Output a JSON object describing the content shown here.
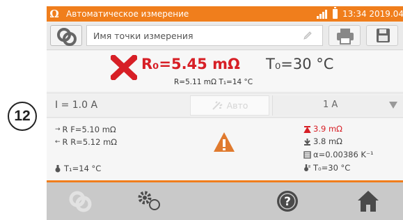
{
  "step_number": "12",
  "statusbar": {
    "app_icon": "omega-icon",
    "title": "Автоматическое измерение",
    "datetime": "13:34 2019.04.10"
  },
  "name_bar": {
    "placeholder": "Имя точки измерения"
  },
  "result": {
    "main_resistance": "R₀=5.45 mΩ",
    "main_temperature": "T₀=30 °C",
    "sub": "R=5.11 mΩ T₁=14 °C",
    "status_icon": "fail-x-icon"
  },
  "current": {
    "label": "I = 1.0 A",
    "auto_label": "Авто",
    "range_value": "1 A"
  },
  "details": {
    "rf": "R F=5.10 mΩ",
    "rr": "R R=5.12 mΩ",
    "t1": "T₁=14 °C",
    "limit_high": "3.9 mΩ",
    "limit_low": "3.8 mΩ",
    "alpha": "α=0.00386 K⁻¹",
    "t0": "T₀=30 °C"
  },
  "colors": {
    "accent": "#f07e1c",
    "error": "#d71f26"
  }
}
